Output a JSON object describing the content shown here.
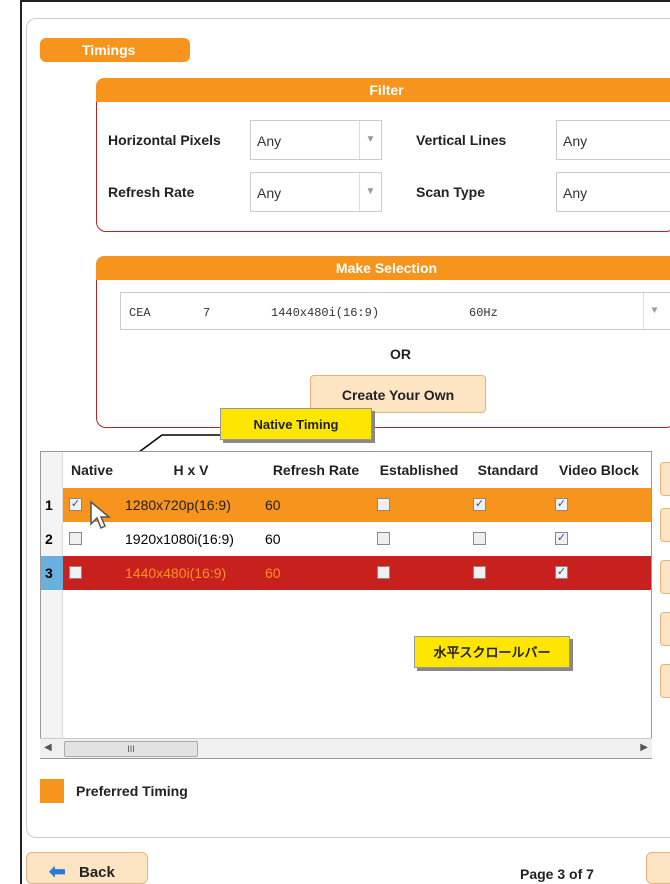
{
  "tab_title": "Timings",
  "filter": {
    "title": "Filter",
    "horizontal_pixels_label": "Horizontal Pixels",
    "horizontal_pixels_value": "Any",
    "vertical_lines_label": "Vertical Lines",
    "vertical_lines_value": "Any",
    "refresh_rate_label": "Refresh Rate",
    "refresh_rate_value": "Any",
    "scan_type_label": "Scan Type",
    "scan_type_value": "Any"
  },
  "selection": {
    "title": "Make Selection",
    "current": {
      "standard": "CEA",
      "id": "7",
      "resolution": "1440x480i(16:9)",
      "rate": "60Hz"
    },
    "or_text": "OR",
    "create_button": "Create Your Own"
  },
  "callouts": {
    "native_timing": "Native Timing",
    "scrollbar": "水平スクロールバー"
  },
  "table": {
    "headers": [
      "Native",
      "H x V",
      "Refresh Rate",
      "Established",
      "Standard",
      "Video Block"
    ],
    "rows": [
      {
        "num": "1",
        "native": true,
        "hxv": "1280x720p(16:9)",
        "refresh": "60",
        "established": false,
        "standard": true,
        "video_block": true
      },
      {
        "num": "2",
        "native": false,
        "hxv": "1920x1080i(16:9)",
        "refresh": "60",
        "established": false,
        "standard": false,
        "video_block": true
      },
      {
        "num": "3",
        "native": false,
        "hxv": "1440x480i(16:9)",
        "refresh": "60",
        "established": false,
        "standard": false,
        "video_block": true
      }
    ],
    "scroll_thumb_label": "III"
  },
  "legend": {
    "preferred_label": "Preferred Timing"
  },
  "footer": {
    "back_label": "Back",
    "page_text": "Page 3 of 7"
  },
  "colors": {
    "accent": "#f7941d",
    "selected_row": "#c8201e",
    "preferred_row": "#f7941d"
  }
}
